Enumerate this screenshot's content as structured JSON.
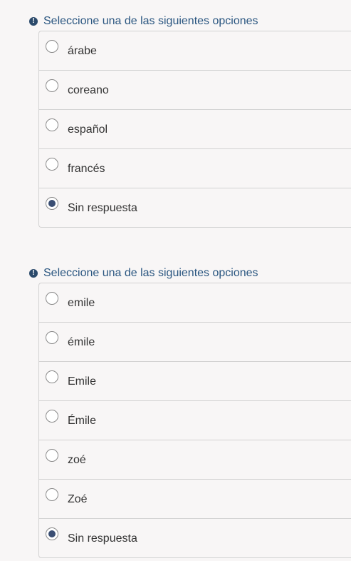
{
  "question1": {
    "hint": "Seleccione una de las siguientes opciones",
    "options": [
      "árabe",
      "coreano",
      "español",
      "francés",
      "Sin respuesta"
    ],
    "selected": "Sin respuesta"
  },
  "question2": {
    "hint": "Seleccione una de las siguientes opciones",
    "options": [
      "emile",
      "émile",
      "Emile",
      "Émile",
      "zoé",
      "Zoé",
      "Sin respuesta"
    ],
    "selected": "Sin respuesta"
  },
  "icons": {
    "hint_icon": "exclamation-circle-icon"
  }
}
